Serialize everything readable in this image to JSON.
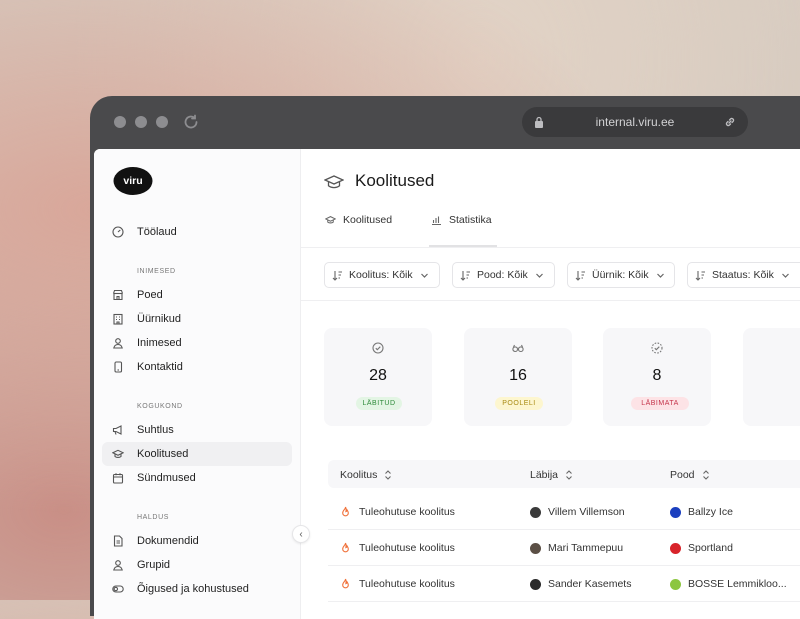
{
  "browser": {
    "url": "internal.viru.ee"
  },
  "sidebar": {
    "logo_text": "viru",
    "top_item": {
      "label": "Töölaud",
      "icon": "dashboard-icon"
    },
    "sections": [
      {
        "title": "INIMESED",
        "items": [
          {
            "label": "Poed",
            "icon": "store-icon"
          },
          {
            "label": "Üürnikud",
            "icon": "building-icon"
          },
          {
            "label": "Inimesed",
            "icon": "user-icon"
          },
          {
            "label": "Kontaktid",
            "icon": "phone-icon"
          }
        ]
      },
      {
        "title": "KOGUKOND",
        "items": [
          {
            "label": "Suhtlus",
            "icon": "megaphone-icon"
          },
          {
            "label": "Koolitused",
            "icon": "graduation-cap-icon",
            "active": true
          },
          {
            "label": "Sündmused",
            "icon": "calendar-icon"
          }
        ]
      },
      {
        "title": "HALDUS",
        "items": [
          {
            "label": "Dokumendid",
            "icon": "document-icon"
          },
          {
            "label": "Grupid",
            "icon": "group-icon"
          },
          {
            "label": "Õigused ja kohustused",
            "icon": "toggle-icon"
          }
        ]
      }
    ]
  },
  "page": {
    "title": "Koolitused",
    "tabs": [
      {
        "label": "Koolitused",
        "icon": "graduation-cap-icon"
      },
      {
        "label": "Statistika",
        "icon": "bar-chart-icon",
        "active": true
      }
    ],
    "filters": [
      {
        "label": "Koolitus: Kõik"
      },
      {
        "label": "Pood: Kõik"
      },
      {
        "label": "Üürnik: Kõik"
      },
      {
        "label": "Staatus: Kõik"
      }
    ]
  },
  "stats": [
    {
      "value": "28",
      "badge": "LÄBITUD",
      "icon": "check-circle-icon",
      "badge_bg": "#e3f5e4",
      "badge_fg": "#2e8a3a"
    },
    {
      "value": "16",
      "badge": "POOLELI",
      "icon": "glasses-icon",
      "badge_bg": "#fdf6cf",
      "badge_fg": "#a88a12"
    },
    {
      "value": "8",
      "badge": "LÄBIMATA",
      "icon": "dashed-check-icon",
      "badge_bg": "#fde3e6",
      "badge_fg": "#c4334a"
    }
  ],
  "table": {
    "columns": [
      "Koolitus",
      "Läbija",
      "Pood"
    ],
    "rows": [
      {
        "course": "Tuleohutuse koolitus",
        "person": "Villem Villemson",
        "shop": "Ballzy Ice",
        "shop_color": "#1b3fbf"
      },
      {
        "course": "Tuleohutuse koolitus",
        "person": "Mari Tammepuu",
        "shop": "Sportland",
        "shop_color": "#d8232a"
      },
      {
        "course": "Tuleohutuse koolitus",
        "person": "Sander Kasemets",
        "shop": "BOSSE Lemmikloo...",
        "shop_color": "#8cc63f"
      }
    ]
  },
  "colors": {
    "accent_flame": "#f0713a",
    "browser_chrome": "#4a4a4c"
  }
}
